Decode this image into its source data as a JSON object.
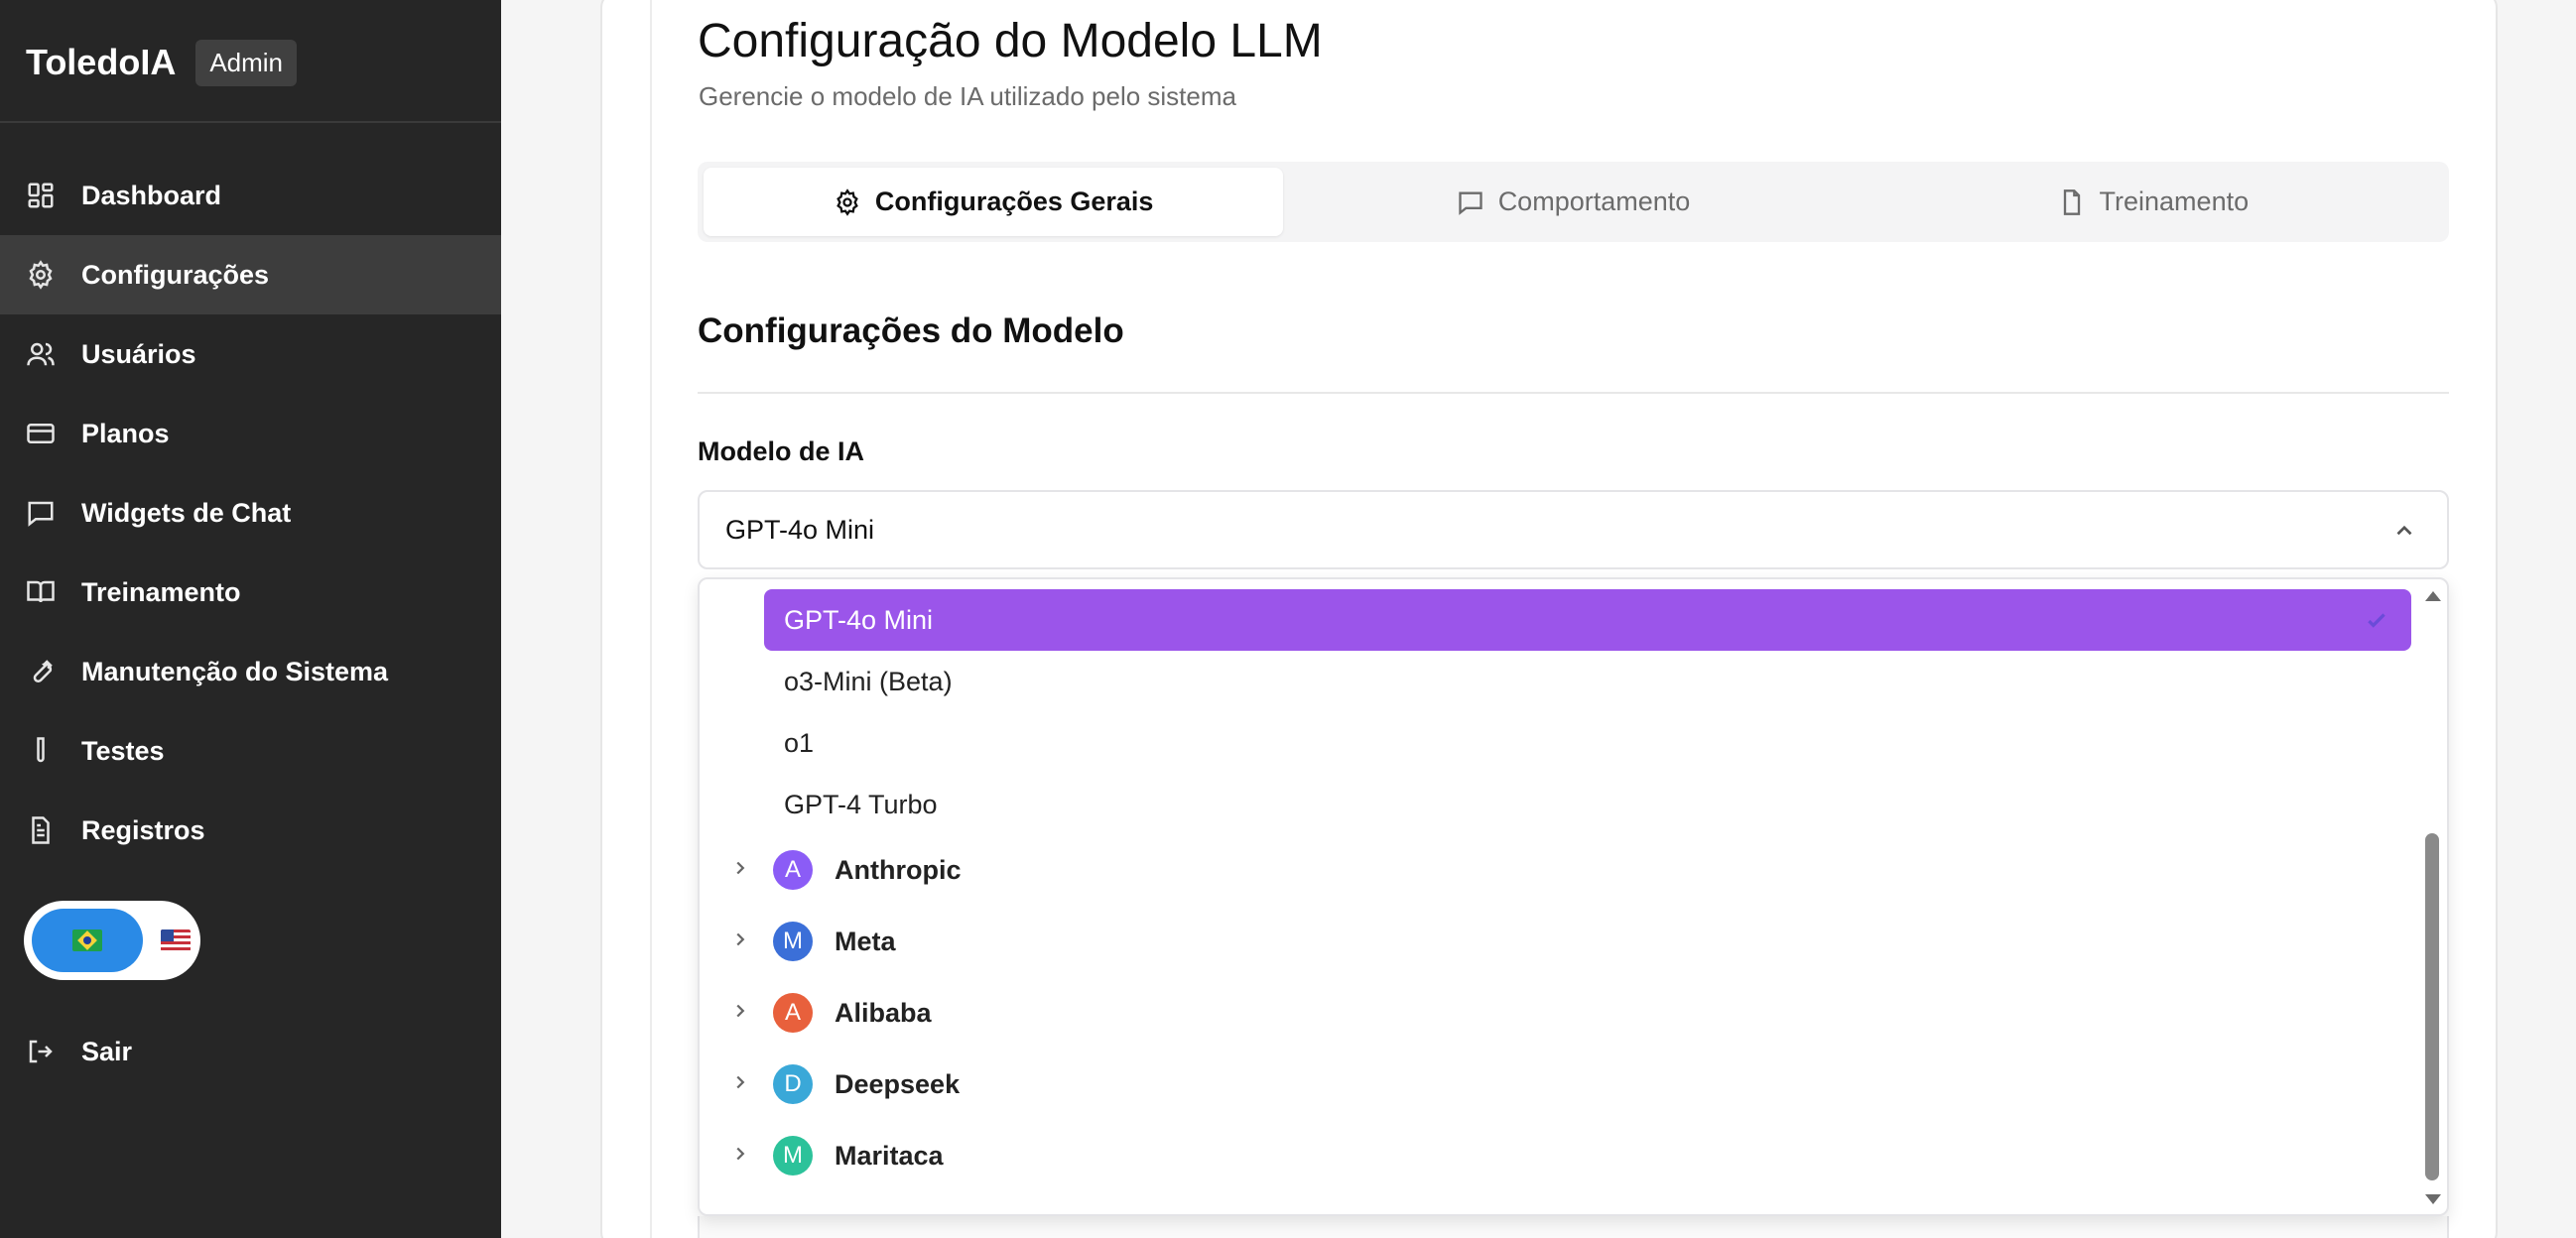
{
  "sidebar": {
    "brand": "ToledoIA",
    "badge": "Admin",
    "items": [
      {
        "label": "Dashboard",
        "icon": "grid-icon"
      },
      {
        "label": "Configurações",
        "icon": "gear-icon"
      },
      {
        "label": "Usuários",
        "icon": "users-icon"
      },
      {
        "label": "Planos",
        "icon": "credit-card-icon"
      },
      {
        "label": "Widgets de Chat",
        "icon": "chat-icon"
      },
      {
        "label": "Treinamento",
        "icon": "book-icon"
      },
      {
        "label": "Manutenção do Sistema",
        "icon": "wrench-icon"
      },
      {
        "label": "Testes",
        "icon": "test-tube-icon"
      },
      {
        "label": "Registros",
        "icon": "file-text-icon"
      }
    ],
    "active_index": 1,
    "logout": "Sair"
  },
  "page": {
    "title": "Configuração do Modelo LLM",
    "subtitle": "Gerencie o modelo de IA utilizado pelo sistema"
  },
  "tabs": [
    {
      "label": "Configurações Gerais",
      "icon": "gear-icon",
      "active": true
    },
    {
      "label": "Comportamento",
      "icon": "chat-icon",
      "active": false
    },
    {
      "label": "Treinamento",
      "icon": "file-icon",
      "active": false
    }
  ],
  "section": {
    "title": "Configurações do Modelo",
    "field_label": "Modelo de IA",
    "selected_value": "GPT-4o Mini"
  },
  "dropdown": {
    "options": [
      "GPT-4o Mini",
      "o3-Mini (Beta)",
      "o1",
      "GPT-4 Turbo"
    ],
    "groups": [
      {
        "label": "Anthropic",
        "initial": "A",
        "color": "#8b5cf6"
      },
      {
        "label": "Meta",
        "initial": "M",
        "color": "#3b6fd8"
      },
      {
        "label": "Alibaba",
        "initial": "A",
        "color": "#e8603c"
      },
      {
        "label": "Deepseek",
        "initial": "D",
        "color": "#3aa8d8"
      },
      {
        "label": "Maritaca",
        "initial": "M",
        "color": "#2cc29a"
      }
    ]
  },
  "colors": {
    "sidebar_bg": "#262626",
    "accent_selected": "#9b55ea"
  }
}
